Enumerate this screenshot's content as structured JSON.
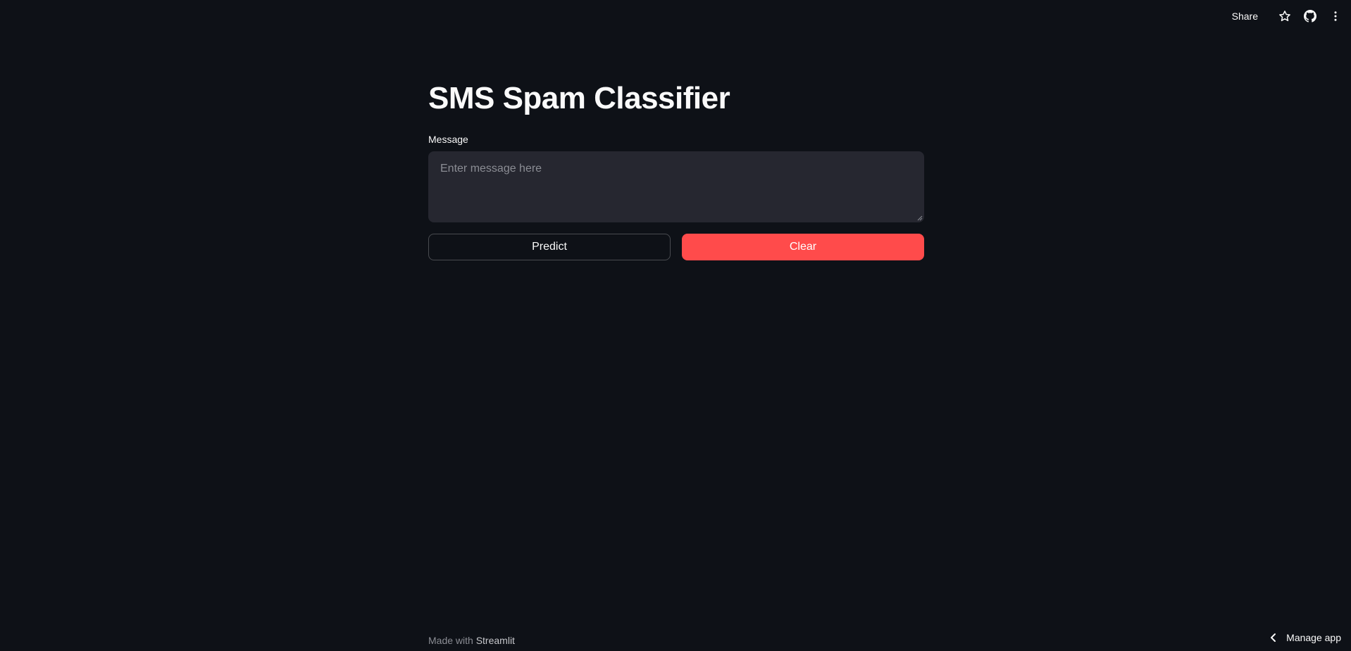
{
  "header": {
    "share_label": "Share",
    "icons": [
      "star-icon",
      "github-icon",
      "more-vertical-icon"
    ]
  },
  "main": {
    "title": "SMS Spam Classifier",
    "message_label": "Message",
    "message_placeholder": "Enter message here",
    "message_value": "",
    "predict_label": "Predict",
    "clear_label": "Clear"
  },
  "footer": {
    "made_with": "Made with",
    "brand": "Streamlit",
    "manage_label": "Manage app"
  },
  "colors": {
    "background": "#0e1117",
    "input_background": "#262730",
    "primary": "#ff4b4b",
    "text": "#fafafa"
  }
}
